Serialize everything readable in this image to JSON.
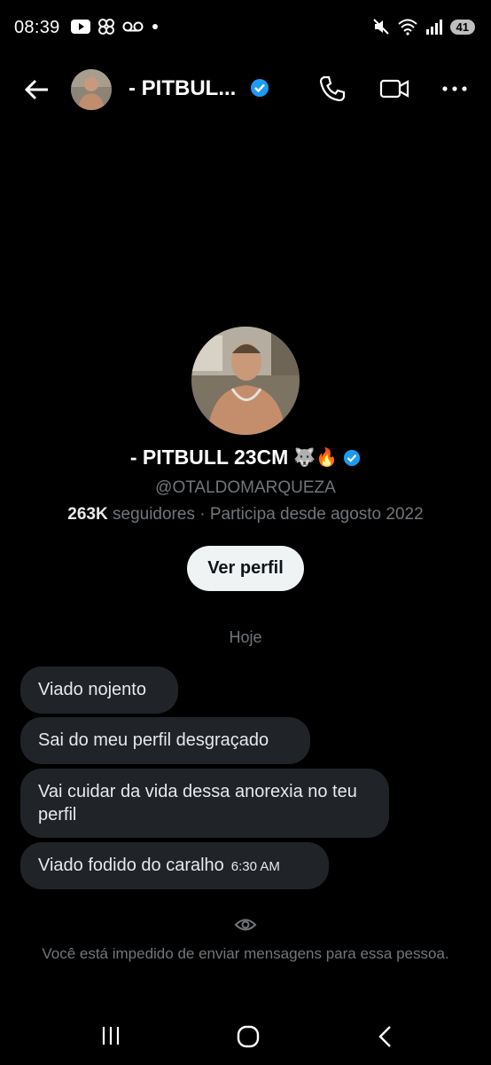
{
  "status_bar": {
    "time": "08:39",
    "battery": "41",
    "icons": [
      "youtube-icon",
      "pinwheel-icon",
      "voicemail-icon",
      "dot-icon",
      "mute-icon",
      "wifi-icon",
      "signal-icon",
      "battery-icon"
    ]
  },
  "header": {
    "name": "- PITBUL...",
    "verified": true
  },
  "profile": {
    "name": "- PITBULL 23CM",
    "emoji": "🐺🔥",
    "handle": "@OTALDOMARQUEZA",
    "followers_count": "263K",
    "followers_text": "seguidores · Participa desde agosto 2022",
    "view_profile_label": "Ver perfil"
  },
  "conversation": {
    "date_label": "Hoje",
    "messages": [
      {
        "text": "Viado nojento"
      },
      {
        "text": "Sai do meu perfil desgraçado"
      },
      {
        "text": "Vai cuidar da vida dessa anorexia no teu perfil"
      },
      {
        "text": "Viado fodido do caralho",
        "time": "6:30 AM"
      }
    ]
  },
  "blocked_notice": "Você está impedido de enviar mensagens para essa pessoa.",
  "colors": {
    "background": "#000000",
    "bubble": "#202327",
    "muted": "#71767b",
    "verified": "#1d9bf0"
  }
}
